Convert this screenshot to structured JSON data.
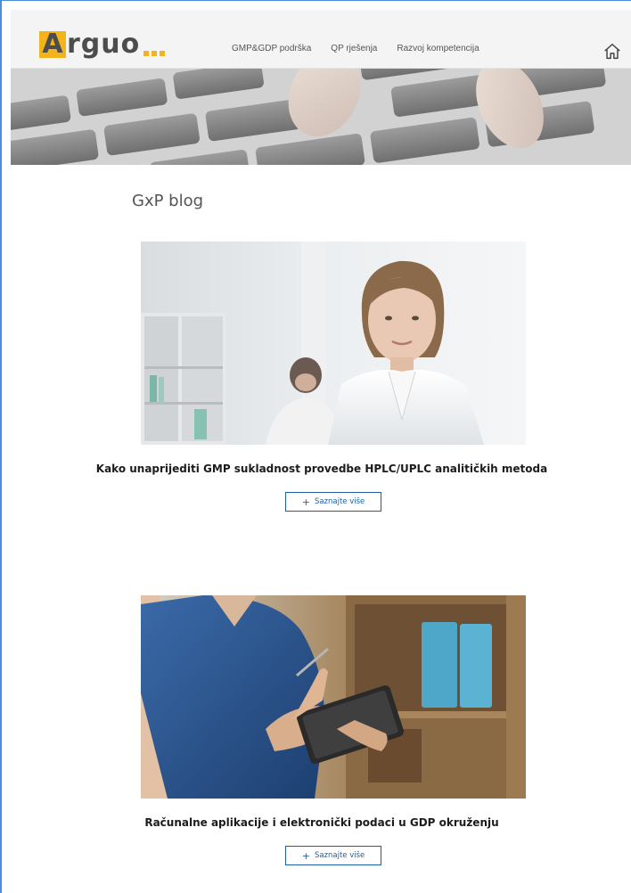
{
  "header": {
    "logo": {
      "letter": "A",
      "rest": "rguo",
      "dots_color": "#f3b31b"
    },
    "nav": [
      {
        "label": "GMP&GDP podrška"
      },
      {
        "label": "QP rješenja"
      },
      {
        "label": "Razvoj kompetencija"
      }
    ],
    "home_icon": "home-icon"
  },
  "page": {
    "title": "GxP blog"
  },
  "posts": [
    {
      "title": "Kako unaprijediti GMP sukladnost provedbe HPLC/UPLC analitičkih metoda",
      "button_label": "Saznajte više",
      "button_icon": "plus-icon"
    },
    {
      "title": "Računalne aplikacije i elektronički podaci u GDP okruženju",
      "button_label": "Saznajte više",
      "button_icon": "plus-icon"
    }
  ],
  "colors": {
    "accent": "#f3b31b",
    "link": "#1c5fa8",
    "frame": "#4a90d9"
  }
}
